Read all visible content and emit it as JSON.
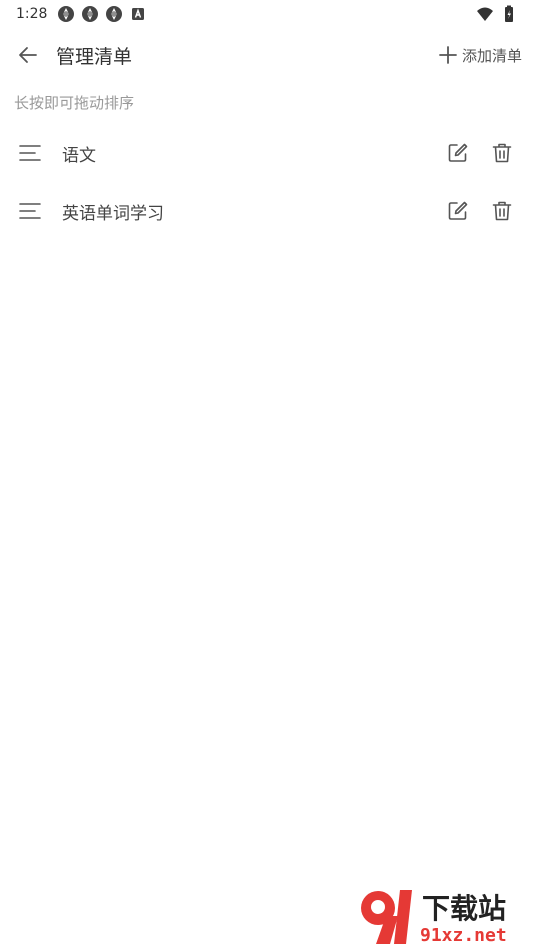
{
  "status_bar": {
    "time": "1:28"
  },
  "header": {
    "title": "管理清单",
    "add_label": "添加清单"
  },
  "hint": "长按即可拖动排序",
  "lists": [
    {
      "label": "语文"
    },
    {
      "label": "英语单词学习"
    }
  ],
  "watermark": {
    "top": "下载站",
    "bottom": "91xz.net"
  },
  "colors": {
    "text": "#444444",
    "hint": "#999999",
    "icon": "#555555",
    "watermark_red": "#e53935"
  }
}
